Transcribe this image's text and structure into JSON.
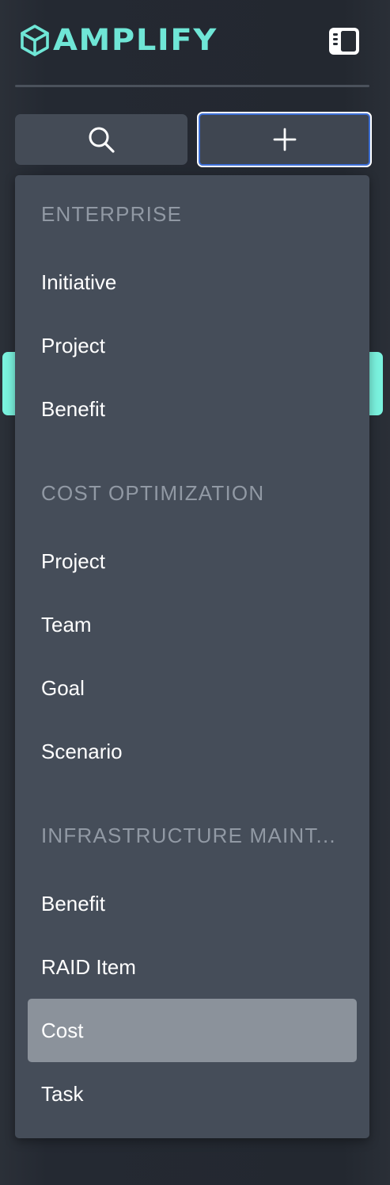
{
  "app": {
    "brand": "AMPLIFY"
  },
  "toolbar": {
    "search_icon": "search-icon",
    "add_icon": "plus-icon",
    "toggle_icon": "sidebar-toggle-icon"
  },
  "colors": {
    "brand": "#6fe6d6",
    "accent": "#7af2de",
    "menu_bg": "#454d59",
    "active_item_bg": "#8b929b",
    "focus_ring": "#3d6fd6"
  },
  "create_menu": {
    "groups": [
      {
        "label": "ENTERPRISE",
        "items": [
          "Initiative",
          "Project",
          "Benefit"
        ]
      },
      {
        "label": "COST OPTIMIZATION",
        "items": [
          "Project",
          "Team",
          "Goal",
          "Scenario"
        ]
      },
      {
        "label": "INFRASTRUCTURE MAINT...",
        "items": [
          "Benefit",
          "RAID Item",
          "Cost",
          "Task"
        ]
      }
    ],
    "highlighted_item": "Cost"
  }
}
